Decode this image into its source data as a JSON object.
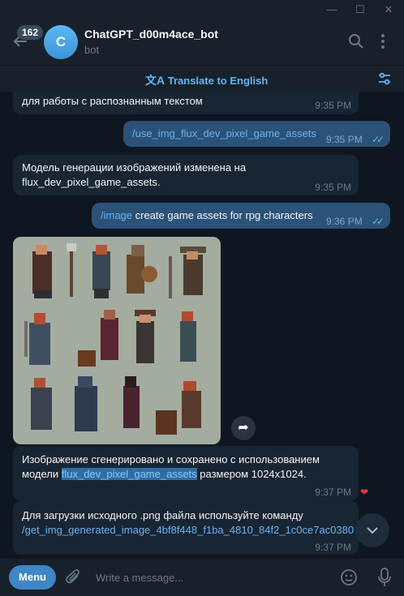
{
  "header": {
    "unread_count": "162",
    "avatar_letter": "C",
    "chat_name": "ChatGPT_d00m4ace_bot",
    "chat_status": "bot",
    "translate_label": "Translate to English"
  },
  "messages": [
    {
      "text": "для работы с распознанным текстом",
      "time": "9:35 PM"
    },
    {
      "command": "/use_img_flux_dev_pixel_game_assets",
      "time": "9:35 PM"
    },
    {
      "line1": "Модель генерации изображений изменена на",
      "line2": "flux_dev_pixel_game_assets.",
      "time": "9:35 PM"
    },
    {
      "command": "/image",
      "text": " create game assets for rpg characters",
      "time": "9:36 PM"
    },
    {
      "line1": "Изображение сгенерировано и сохранено с использованием",
      "line2_prefix": "модели ",
      "line2_highlight": "flux_dev_pixel_game_assets",
      "line2_suffix": " размером 1024x1024.",
      "time": "9:37 PM"
    },
    {
      "line1": "Для загрузки исходного .png файла используйте команду",
      "command": "/get_img_generated_image_4bf8f448_f1ba_4810_84f2_1c0ce7ac0380",
      "time": "9:37 PM"
    }
  ],
  "composer": {
    "menu_label": "Menu",
    "placeholder": "Write a message..."
  },
  "icons": [
    "back-arrow-icon",
    "search-icon",
    "more-icon",
    "translate-icon",
    "filter-icon",
    "share-icon",
    "heart-icon",
    "chevron-down-icon",
    "attach-icon",
    "emoji-icon",
    "mic-icon"
  ],
  "colors": {
    "accent": "#5eb5f7",
    "incoming": "#182533",
    "outgoing": "#2b5278",
    "background": "#0e1621"
  }
}
